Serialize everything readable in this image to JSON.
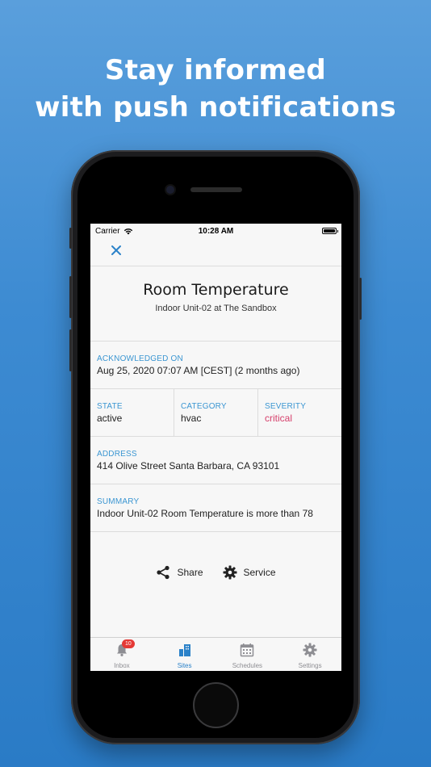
{
  "headline": {
    "line1": "Stay informed",
    "line2": "with push notifications"
  },
  "statusbar": {
    "carrier": "Carrier",
    "time": "10:28 AM"
  },
  "alarm": {
    "title": "Room Temperature",
    "subtitle": "Indoor Unit-02 at The Sandbox",
    "acknowledged": {
      "label": "ACKNOWLEDGED ON",
      "value": "Aug 25, 2020 07:07 AM [CEST] (2 months ago)"
    },
    "state": {
      "label": "STATE",
      "value": "active"
    },
    "category": {
      "label": "CATEGORY",
      "value": "hvac"
    },
    "severity": {
      "label": "SEVERITY",
      "value": "critical",
      "color": "#d6406c"
    },
    "address": {
      "label": "ADDRESS",
      "value": "414 Olive Street Santa Barbara, CA 93101"
    },
    "summary": {
      "label": "SUMMARY",
      "value": "Indoor Unit-02 Room Temperature is more than 78"
    }
  },
  "actions": {
    "share_label": "Share",
    "service_label": "Service"
  },
  "tabbar": {
    "inbox": {
      "label": "Inbox",
      "badge": "10"
    },
    "sites": {
      "label": "Sites"
    },
    "schedules": {
      "label": "Schedules"
    },
    "settings": {
      "label": "Settings"
    }
  },
  "colors": {
    "accent": "#2b82c9",
    "label_blue": "#3b96d2",
    "critical": "#d6406c",
    "background": "#3d8bd2"
  }
}
